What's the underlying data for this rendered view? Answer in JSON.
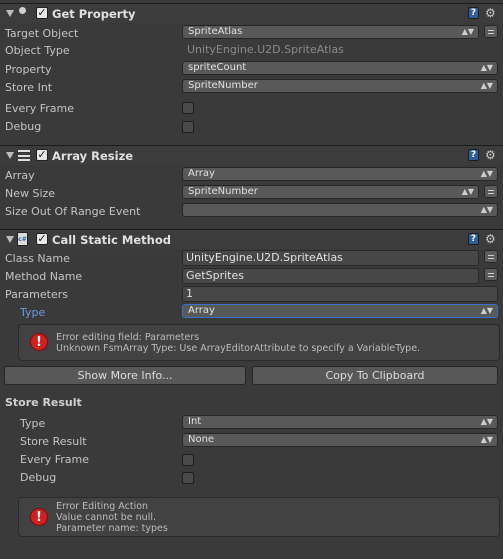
{
  "get_property": {
    "title": "Get Property",
    "enabled": true,
    "rows": {
      "target_object": {
        "label": "Target Object",
        "value": "SpriteAtlas"
      },
      "object_type": {
        "label": "Object Type",
        "value": "UnityEngine.U2D.SpriteAtlas"
      },
      "property": {
        "label": "Property",
        "value": "spriteCount"
      },
      "store_int": {
        "label": "Store Int",
        "value": "SpriteNumber"
      },
      "every_frame": {
        "label": "Every Frame"
      },
      "debug": {
        "label": "Debug"
      }
    }
  },
  "array_resize": {
    "title": "Array Resize",
    "enabled": true,
    "rows": {
      "array": {
        "label": "Array",
        "value": "Array"
      },
      "new_size": {
        "label": "New Size",
        "value": "SpriteNumber"
      },
      "size_out_of_range": {
        "label": "Size Out Of Range Event",
        "value": ""
      }
    }
  },
  "call_static_method": {
    "title": "Call Static Method",
    "enabled": true,
    "rows": {
      "class_name": {
        "label": "Class Name",
        "value": "UnityEngine.U2D.SpriteAtlas"
      },
      "method_name": {
        "label": "Method Name",
        "value": "GetSprites"
      },
      "parameters": {
        "label": "Parameters",
        "value": "1"
      },
      "type": {
        "label": "Type",
        "value": "Array"
      }
    },
    "error_1": {
      "line1": "Error editing field: Parameters",
      "line2": "Unknown FsmArray Type: Use ArrayEditorAttribute to specify a VariableType."
    },
    "buttons": {
      "show_more": "Show More Info...",
      "copy": "Copy To Clipboard"
    },
    "store_result": {
      "heading": "Store Result",
      "type": {
        "label": "Type",
        "value": "Int"
      },
      "store": {
        "label": "Store Result",
        "value": "None"
      },
      "every_frame": {
        "label": "Every Frame"
      },
      "debug": {
        "label": "Debug"
      }
    },
    "error_2": {
      "line1": "Error Editing Action",
      "line2": "Value cannot be null.",
      "line3": "Parameter name: types"
    }
  },
  "icons": [
    "fold-arrow-icon",
    "circle-icon",
    "list-icon",
    "script-icon",
    "help-icon",
    "gear-icon",
    "error-icon",
    "minus-icon"
  ],
  "colors": {
    "accent_blue": "#6a9ae8",
    "error_red": "#d21f1f",
    "background": "#3a3a3a"
  }
}
